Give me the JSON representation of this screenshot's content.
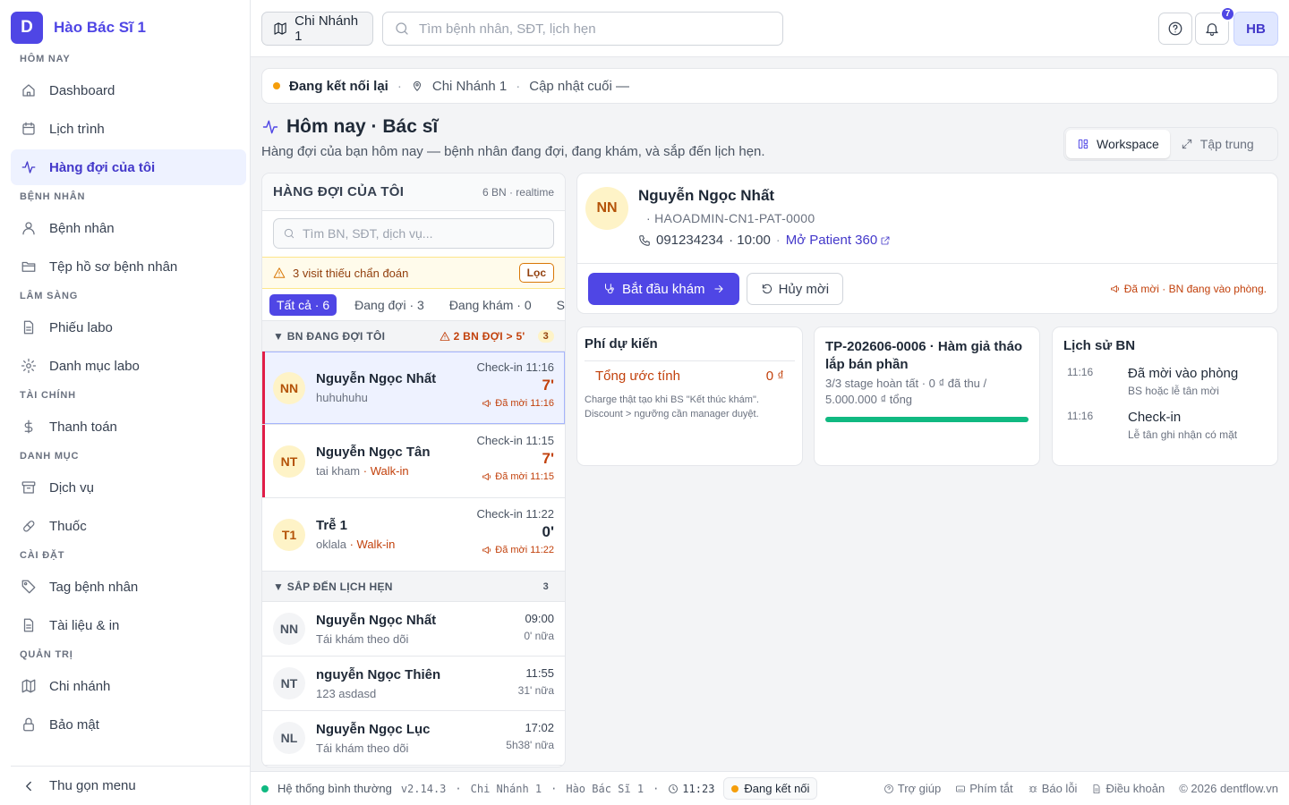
{
  "brand": {
    "logo_letter": "D",
    "name": "Hào Bác Sĩ 1",
    "accent": "#4f46e5"
  },
  "sidebar": {
    "sections": [
      {
        "title": "HÔM NAY",
        "items": [
          {
            "label": "Dashboard",
            "icon": "home-icon"
          },
          {
            "label": "Lịch trình",
            "icon": "calendar-icon"
          },
          {
            "label": "Hàng đợi của tôi",
            "icon": "activity-icon",
            "active": true
          }
        ]
      },
      {
        "title": "BỆNH NHÂN",
        "items": [
          {
            "label": "Bệnh nhân",
            "icon": "user-icon"
          },
          {
            "label": "Tệp hồ sơ bệnh nhân",
            "icon": "folder-icon"
          }
        ]
      },
      {
        "title": "LÂM SÀNG",
        "items": [
          {
            "label": "Phiếu labo",
            "icon": "file-text-icon"
          },
          {
            "label": "Danh mục labo",
            "icon": "gear-icon"
          }
        ]
      },
      {
        "title": "TÀI CHÍNH",
        "items": [
          {
            "label": "Thanh toán",
            "icon": "dollar-icon"
          }
        ]
      },
      {
        "title": "DANH MỤC",
        "items": [
          {
            "label": "Dịch vụ",
            "icon": "archive-icon"
          },
          {
            "label": "Thuốc",
            "icon": "pill-icon"
          }
        ]
      },
      {
        "title": "CÀI ĐẶT",
        "items": [
          {
            "label": "Tag bệnh nhân",
            "icon": "tag-icon"
          },
          {
            "label": "Tài liệu & in",
            "icon": "document-icon"
          }
        ]
      },
      {
        "title": "QUẢN TRỊ",
        "items": [
          {
            "label": "Chi nhánh",
            "icon": "map-icon"
          },
          {
            "label": "Bảo mật",
            "icon": "lock-icon"
          }
        ]
      }
    ],
    "collapse_label": "Thu gọn menu"
  },
  "topbar": {
    "branch": "Chi Nhánh 1",
    "search_placeholder": "Tìm bệnh nhân, SĐT, lịch hẹn",
    "notif_count": "7",
    "user_initials": "HB"
  },
  "status": {
    "connection": "Đang kết nối lại",
    "branch": "Chi Nhánh 1",
    "last_update": "Cập nhật cuối —"
  },
  "page": {
    "title": "Hôm nay · Bác sĩ",
    "subtitle": "Hàng đợi của bạn hôm nay — bệnh nhân đang đợi, đang khám, và sắp đến lịch hẹn.",
    "view_workspace": "Workspace",
    "view_focus": "Tập trung"
  },
  "queue": {
    "title": "HÀNG ĐỢI CỦA TÔI",
    "meta": "6 BN · realtime",
    "search_placeholder": "Tìm BN, SĐT, dịch vụ...",
    "warning": "3 visit thiếu chẩn đoán",
    "filter_label": "Lọc",
    "tabs": [
      "Tất cả · 6",
      "Đang đợi · 3",
      "Đang khám · 0",
      "Sắp đến · 3"
    ],
    "waiting_group": {
      "title": "▼ BN ĐANG ĐỢI TÔI",
      "alert": "2 BN ĐỢI > 5'",
      "count": "3"
    },
    "waiting": [
      {
        "initials": "NN",
        "name": "Nguyễn Ngọc Nhất",
        "note": "huhuhuhu",
        "walkin": "",
        "checkin": "Check-in 11:16",
        "wait": "7'",
        "invited": "Đã mời 11:16",
        "selected": true,
        "flag": true
      },
      {
        "initials": "NT",
        "name": "Nguyễn Ngọc Tân",
        "note": "tai kham",
        "walkin": "· Walk-in",
        "checkin": "Check-in 11:15",
        "wait": "7'",
        "invited": "Đã mời 11:15",
        "selected": false,
        "flag": true
      },
      {
        "initials": "T1",
        "name": "Trễ 1",
        "note": "oklala",
        "walkin": "· Walk-in",
        "checkin": "Check-in 11:22",
        "wait": "0'",
        "invited": "Đã mời 11:22",
        "selected": false,
        "flag": false
      }
    ],
    "upcoming_group": {
      "title": "▼ SẮP ĐẾN LỊCH HẸN",
      "count": "3"
    },
    "upcoming": [
      {
        "initials": "NN",
        "name": "Nguyễn Ngọc Nhất",
        "note": "Tái khám theo dõi",
        "time": "09:00",
        "rel": "0' nữa"
      },
      {
        "initials": "NT",
        "name": "nguyễn Ngọc Thiên",
        "note": "123 asdasd",
        "time": "11:55",
        "rel": "31' nữa"
      },
      {
        "initials": "NL",
        "name": "Nguyễn Ngọc Lục",
        "note": "Tái khám theo dõi",
        "time": "17:02",
        "rel": "5h38' nữa"
      }
    ]
  },
  "patient": {
    "initials": "NN",
    "name": "Nguyễn Ngọc Nhất",
    "code": "· HAOADMIN-CN1-PAT-0000",
    "phone": "091234234",
    "time": "· 10:00",
    "link": "Mở Patient 360",
    "start_btn": "Bắt đầu khám",
    "cancel_btn": "Hủy mời",
    "status": "Đã mời · BN đang vào phòng."
  },
  "fee": {
    "title": "Phí dự kiến",
    "label": "Tổng ước tính",
    "value": "0 ₫",
    "note": "Charge thật tạo khi BS \"Kết thúc khám\". Discount > ngưỡng cần manager duyệt."
  },
  "treatment": {
    "title": "TP-202606-0006 · Hàm giả tháo lắp bán phần",
    "detail": "3/3 stage hoàn tất · 0 ₫ đã thu / 5.000.000 ₫ tổng",
    "progress": 1.0
  },
  "history": {
    "title": "Lịch sử BN",
    "items": [
      {
        "time": "11:16",
        "main": "Đã mời vào phòng",
        "sub": "BS hoặc lễ tân mời"
      },
      {
        "time": "11:16",
        "main": "Check-in",
        "sub": "Lễ tân ghi nhận có mặt"
      }
    ]
  },
  "footer": {
    "system": "Hệ thống bình thường",
    "version": "v2.14.3",
    "branch": "Chi Nhánh 1",
    "doctor": "Hào Bác Sĩ 1",
    "clock": "11:23",
    "connection": "Đang kết nối",
    "links": [
      "Trợ giúp",
      "Phím tắt",
      "Báo lỗi",
      "Điều khoản"
    ],
    "copyright": "© 2026 dentflow.vn"
  }
}
